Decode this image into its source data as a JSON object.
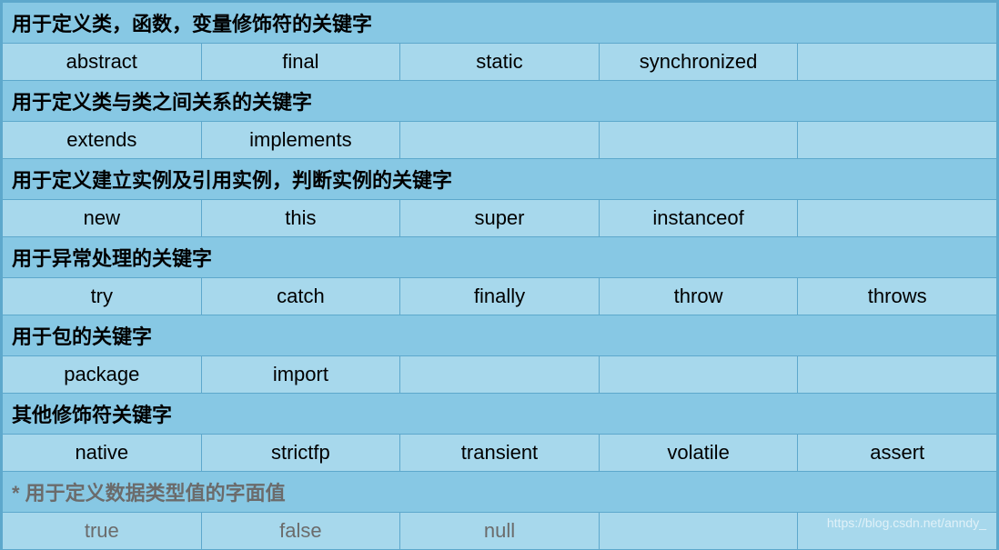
{
  "sections": [
    {
      "header": "用于定义类，函数，变量修饰符的关键字",
      "gray": false,
      "cells": [
        "abstract",
        "final",
        "static",
        "synchronized",
        ""
      ]
    },
    {
      "header": "用于定义类与类之间关系的关键字",
      "gray": false,
      "cells": [
        "extends",
        "implements",
        "",
        "",
        ""
      ]
    },
    {
      "header": "用于定义建立实例及引用实例，判断实例的关键字",
      "gray": false,
      "cells": [
        "new",
        "this",
        "super",
        "instanceof",
        ""
      ]
    },
    {
      "header": "用于异常处理的关键字",
      "gray": false,
      "cells": [
        "try",
        "catch",
        "finally",
        "throw",
        "throws"
      ]
    },
    {
      "header": "用于包的关键字",
      "gray": false,
      "cells": [
        "package",
        "import",
        "",
        "",
        ""
      ]
    },
    {
      "header": "其他修饰符关键字",
      "gray": false,
      "cells": [
        "native",
        "strictfp",
        "transient",
        "volatile",
        "assert"
      ]
    },
    {
      "header": "* 用于定义数据类型值的字面值",
      "gray": true,
      "cells": [
        "true",
        "false",
        "null",
        "",
        ""
      ]
    }
  ],
  "watermark": "https://blog.csdn.net/anndy_"
}
